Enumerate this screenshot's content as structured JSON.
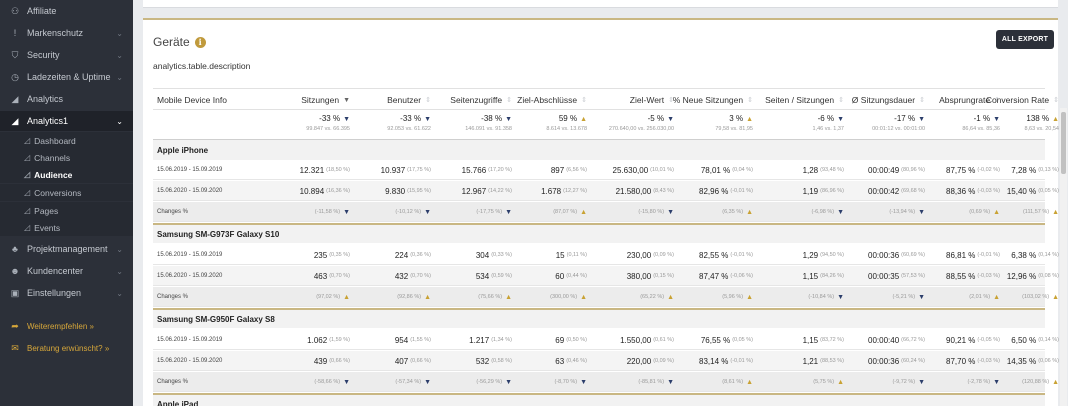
{
  "sidebar": {
    "items": [
      {
        "label": "Affiliate",
        "icon": "handshake-icon",
        "glyph": "⚇",
        "chevron": false
      },
      {
        "label": "Markenschutz",
        "icon": "exclamation-icon",
        "glyph": "!",
        "chevron": true
      },
      {
        "label": "Security",
        "icon": "shield-icon",
        "glyph": "⛉",
        "chevron": true
      },
      {
        "label": "Ladezeiten & Uptime",
        "icon": "clock-icon",
        "glyph": "◷",
        "chevron": true
      },
      {
        "label": "Analytics",
        "icon": "chart-icon",
        "glyph": "◢",
        "chevron": false
      },
      {
        "label": "Analytics1",
        "icon": "chart-icon",
        "glyph": "◢",
        "chevron": true,
        "active": true
      }
    ],
    "subitems": [
      {
        "label": "Dashboard",
        "glyph": "◿"
      },
      {
        "label": "Channels",
        "glyph": "◿"
      },
      {
        "label": "Audience",
        "glyph": "◿",
        "active": true
      },
      {
        "label": "Conversions",
        "glyph": "◿"
      },
      {
        "label": "Pages",
        "glyph": "◿"
      },
      {
        "label": "Events",
        "glyph": "◿"
      }
    ],
    "items2": [
      {
        "label": "Projektmanagement",
        "icon": "sitemap-icon",
        "glyph": "♣",
        "chevron": true
      },
      {
        "label": "Kundencenter",
        "icon": "users-icon",
        "glyph": "☻",
        "chevron": true
      },
      {
        "label": "Einstellungen",
        "icon": "lock-icon",
        "glyph": "▣",
        "chevron": true
      }
    ],
    "gold": [
      {
        "label": "Weiterempfehlen »",
        "icon": "share-icon",
        "glyph": "➦"
      },
      {
        "label": "Beratung erwünscht? »",
        "icon": "chat-icon",
        "glyph": "✉"
      }
    ]
  },
  "card": {
    "title": "Geräte",
    "info": "i",
    "export_label": "ALL EXPORT",
    "description": "analytics.table.description"
  },
  "table": {
    "columns": [
      "Mobile Device Info",
      "Sitzungen",
      "Benutzer",
      "Seitenzugriffe",
      "Ziel-Abschlüsse",
      "Ziel-Wert",
      "% Neue Sitzungen",
      "Seiten / Sitzungen",
      "Ø Sitzungsdauer",
      "Absprungrate",
      "Conversion Rate"
    ],
    "summary": [
      {
        "pct": "-33 %",
        "dir": "down",
        "vs": "99.847 vs. 66.395"
      },
      {
        "pct": "-33 %",
        "dir": "down",
        "vs": "92.053 vs. 61.622"
      },
      {
        "pct": "-38 %",
        "dir": "down",
        "vs": "146.091 vs. 91.358"
      },
      {
        "pct": "59 %",
        "dir": "up",
        "vs": "8.614 vs. 13.678"
      },
      {
        "pct": "-5 %",
        "dir": "down",
        "vs": "270.640,00 vs. 256.030,00"
      },
      {
        "pct": "3 %",
        "dir": "up",
        "vs": "79,58 vs. 81,95"
      },
      {
        "pct": "-6 %",
        "dir": "down",
        "vs": "1,46 vs. 1,37"
      },
      {
        "pct": "-17 %",
        "dir": "down",
        "vs": "00:01:12 vs. 00:01:00"
      },
      {
        "pct": "-1 %",
        "dir": "down",
        "vs": "86,64 vs. 85,36"
      },
      {
        "pct": "138 %",
        "dir": "up",
        "vs": "8,63 vs. 20,54"
      }
    ],
    "groups": [
      {
        "name": "Apple iPhone",
        "rows": [
          {
            "date": "15.06.2019 - 15.09.2019",
            "cells": [
              [
                "12.321",
                "(18,50 %)"
              ],
              [
                "10.937",
                "(17,75 %)"
              ],
              [
                "15.766",
                "(17,20 %)"
              ],
              [
                "897",
                "(6,56 %)"
              ],
              [
                "25.630,00",
                "(10,01 %)"
              ],
              [
                "78,01 %",
                "(0,04 %)"
              ],
              [
                "1,28",
                "(93,48 %)"
              ],
              [
                "00:00:49",
                "(80,96 %)"
              ],
              [
                "87,75 %",
                "(-0,02 %)"
              ],
              [
                "7,28 %",
                "(0,13 %)"
              ]
            ]
          },
          {
            "date": "15.06.2020 - 15.09.2020",
            "cells": [
              [
                "10.894",
                "(16,36 %)"
              ],
              [
                "9.830",
                "(15,95 %)"
              ],
              [
                "12.967",
                "(14,22 %)"
              ],
              [
                "1.678",
                "(12,27 %)"
              ],
              [
                "21.580,00",
                "(8,43 %)"
              ],
              [
                "82,96 %",
                "(-0,01 %)"
              ],
              [
                "1,19",
                "(86,96 %)"
              ],
              [
                "00:00:42",
                "(69,68 %)"
              ],
              [
                "88,36 %",
                "(-0,03 %)"
              ],
              [
                "15,40 %",
                "(0,05 %)"
              ]
            ]
          }
        ],
        "changes": [
          "(-11,58 %)|down",
          "(-10,12 %)|down",
          "(-17,75 %)|down",
          "(87,07 %)|up",
          "(-15,80 %)|down",
          "(6,35 %)|up",
          "(-6,98 %)|down",
          "(-13,94 %)|down",
          "(0,69 %)|up",
          "(111,57 %)|up"
        ]
      },
      {
        "name": "Samsung SM-G973F Galaxy S10",
        "rows": [
          {
            "date": "15.06.2019 - 15.09.2019",
            "cells": [
              [
                "235",
                "(0,35 %)"
              ],
              [
                "224",
                "(0,36 %)"
              ],
              [
                "304",
                "(0,33 %)"
              ],
              [
                "15",
                "(0,11 %)"
              ],
              [
                "230,00",
                "(0,09 %)"
              ],
              [
                "82,55 %",
                "(-0,01 %)"
              ],
              [
                "1,29",
                "(94,50 %)"
              ],
              [
                "00:00:36",
                "(60,69 %)"
              ],
              [
                "86,81 %",
                "(-0,01 %)"
              ],
              [
                "6,38 %",
                "(0,14 %)"
              ]
            ]
          },
          {
            "date": "15.06.2020 - 15.09.2020",
            "cells": [
              [
                "463",
                "(0,70 %)"
              ],
              [
                "432",
                "(0,70 %)"
              ],
              [
                "534",
                "(0,59 %)"
              ],
              [
                "60",
                "(0,44 %)"
              ],
              [
                "380,00",
                "(0,15 %)"
              ],
              [
                "87,47 %",
                "(-0,06 %)"
              ],
              [
                "1,15",
                "(84,26 %)"
              ],
              [
                "00:00:35",
                "(57,53 %)"
              ],
              [
                "88,55 %",
                "(-0,03 %)"
              ],
              [
                "12,96 %",
                "(0,08 %)"
              ]
            ]
          }
        ],
        "changes": [
          "(97,02 %)|up",
          "(92,86 %)|up",
          "(75,66 %)|up",
          "(300,00 %)|up",
          "(65,22 %)|up",
          "(5,96 %)|up",
          "(-10,84 %)|down",
          "(-5,21 %)|down",
          "(2,01 %)|up",
          "(103,02 %)|up"
        ]
      },
      {
        "name": "Samsung SM-G950F Galaxy S8",
        "rows": [
          {
            "date": "15.06.2019 - 15.09.2019",
            "cells": [
              [
                "1.062",
                "(1,59 %)"
              ],
              [
                "954",
                "(1,55 %)"
              ],
              [
                "1.217",
                "(1,34 %)"
              ],
              [
                "69",
                "(0,50 %)"
              ],
              [
                "1.550,00",
                "(0,61 %)"
              ],
              [
                "76,55 %",
                "(0,05 %)"
              ],
              [
                "1,15",
                "(83,72 %)"
              ],
              [
                "00:00:40",
                "(66,72 %)"
              ],
              [
                "90,21 %",
                "(-0,05 %)"
              ],
              [
                "6,50 %",
                "(0,14 %)"
              ]
            ]
          },
          {
            "date": "15.06.2020 - 15.09.2020",
            "cells": [
              [
                "439",
                "(0,66 %)"
              ],
              [
                "407",
                "(0,66 %)"
              ],
              [
                "532",
                "(0,58 %)"
              ],
              [
                "63",
                "(0,46 %)"
              ],
              [
                "220,00",
                "(0,09 %)"
              ],
              [
                "83,14 %",
                "(-0,01 %)"
              ],
              [
                "1,21",
                "(88,53 %)"
              ],
              [
                "00:00:36",
                "(60,24 %)"
              ],
              [
                "87,70 %",
                "(-0,03 %)"
              ],
              [
                "14,35 %",
                "(0,06 %)"
              ]
            ]
          }
        ],
        "changes": [
          "(-58,66 %)|down",
          "(-57,34 %)|down",
          "(-56,29 %)|down",
          "(-8,70 %)|down",
          "(-85,81 %)|down",
          "(8,61 %)|up",
          "(5,75 %)|up",
          "(-9,72 %)|down",
          "(-2,78 %)|down",
          "(120,88 %)|up"
        ]
      },
      {
        "name": "Apple iPad",
        "rows": [],
        "changes": []
      }
    ],
    "changes_label": "Changes %"
  }
}
